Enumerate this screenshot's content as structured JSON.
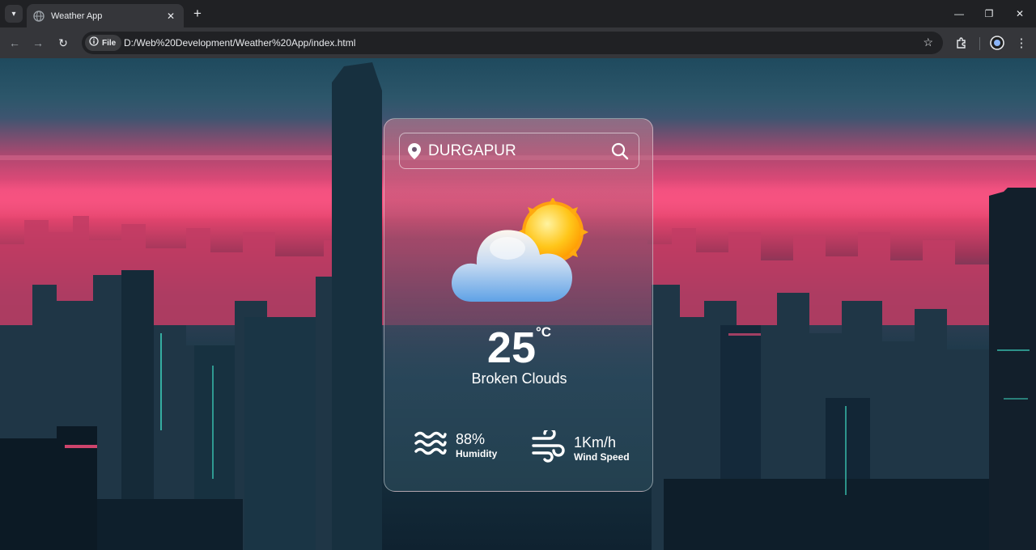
{
  "browser": {
    "tab_title": "Weather App",
    "new_tab": "+",
    "site_chip": "File",
    "url": "D:/Web%20Development/Weather%20App/index.html",
    "minimize": "—",
    "maximize": "❐",
    "close": "✕"
  },
  "app": {
    "search": {
      "value": "DURGAPUR",
      "placeholder": ""
    },
    "weather_icon": "sun-behind-cloud-icon",
    "temperature": {
      "value": "25",
      "unit": "°C"
    },
    "description": "Broken Clouds",
    "humidity": {
      "value": "88%",
      "label": "Humidity",
      "icon": "water-waves-icon"
    },
    "wind": {
      "value": "1Km/h",
      "label": "Wind Speed",
      "icon": "wind-icon"
    }
  },
  "colors": {
    "chrome_bg": "#202124",
    "toolbar_bg": "#35363a",
    "neon_pink": "#ef4a7a",
    "skyline_teal": "#1d3a4a",
    "text": "#ffffff"
  }
}
